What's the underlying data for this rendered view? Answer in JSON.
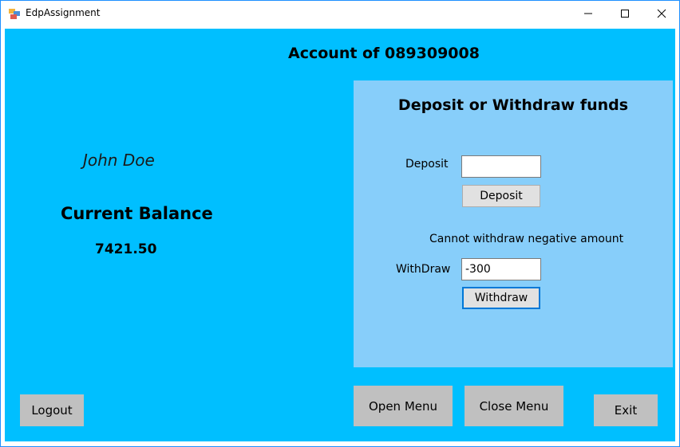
{
  "window": {
    "title": "EdpAssignment"
  },
  "account": {
    "title": "Account of 089309008",
    "user_name": "John Doe",
    "balance_label": "Current Balance",
    "balance_value": "7421.50"
  },
  "funds_panel": {
    "title": "Deposit or Withdraw funds",
    "deposit_label": "Deposit",
    "deposit_value": "",
    "deposit_button": "Deposit",
    "error_message": "Cannot withdraw negative amount",
    "withdraw_label": "WithDraw",
    "withdraw_value": "-300",
    "withdraw_button": "Withdraw"
  },
  "footer": {
    "logout_button": "Logout",
    "open_menu_button": "Open Menu",
    "close_menu_button": "Close Menu",
    "exit_button": "Exit"
  },
  "colors": {
    "background": "#00bfff",
    "panel": "#87cefa",
    "button_grey": "#c0c0c0"
  },
  "icons": {
    "app": "app-window-icon",
    "minimize": "minimize-icon",
    "maximize": "maximize-icon",
    "close": "close-icon"
  }
}
